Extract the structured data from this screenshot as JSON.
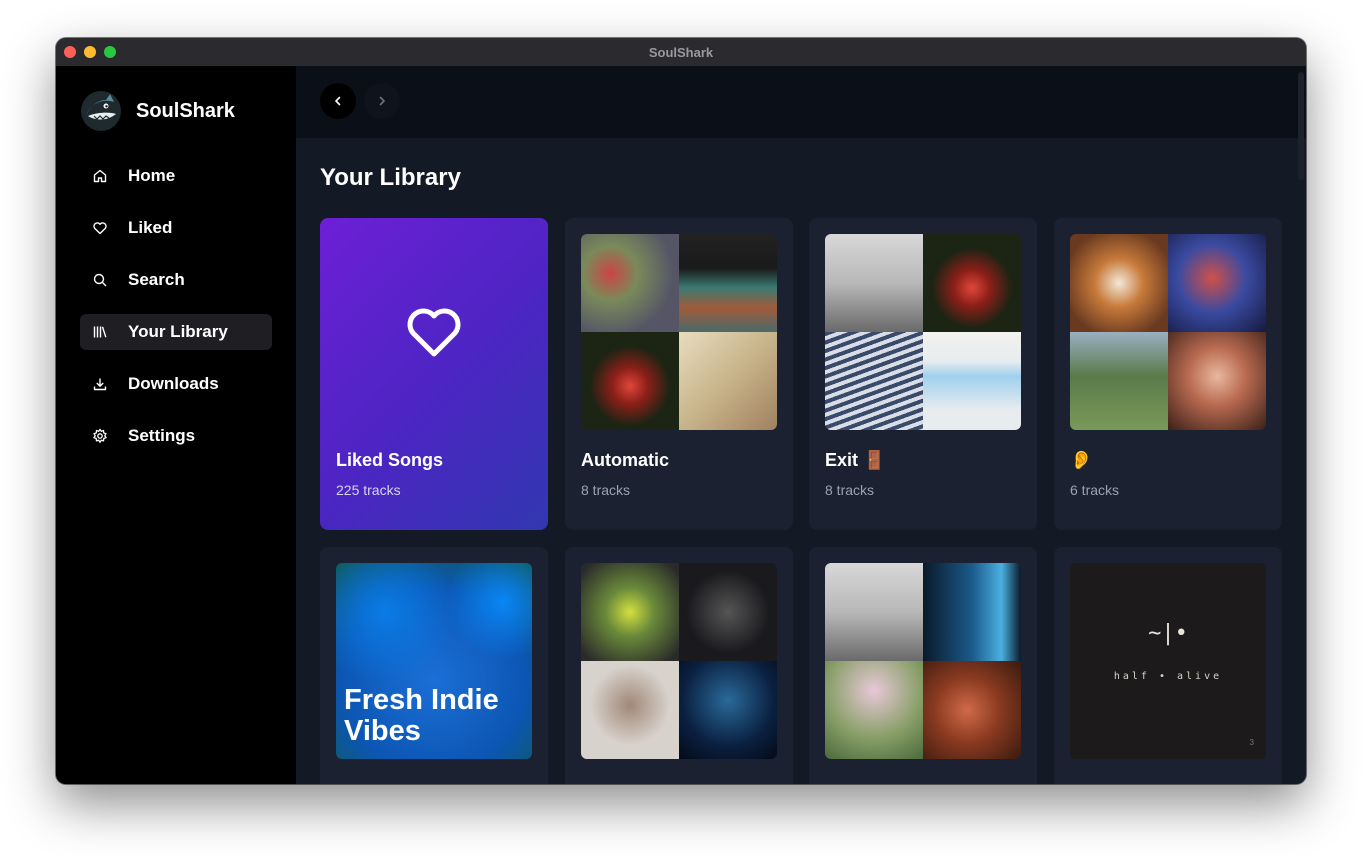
{
  "window": {
    "title": "SoulShark"
  },
  "brand": {
    "name": "SoulShark"
  },
  "sidebar": {
    "items": [
      {
        "label": "Home",
        "icon": "home-icon"
      },
      {
        "label": "Liked",
        "icon": "heart-icon"
      },
      {
        "label": "Search",
        "icon": "search-icon"
      },
      {
        "label": "Your Library",
        "icon": "library-icon",
        "active": true
      },
      {
        "label": "Downloads",
        "icon": "download-icon"
      },
      {
        "label": "Settings",
        "icon": "gear-icon"
      }
    ]
  },
  "main": {
    "title": "Your Library",
    "cards": [
      {
        "title": "Liked Songs",
        "subtitle": "225 tracks"
      },
      {
        "title": "Automatic",
        "subtitle": "8 tracks",
        "art": [
          "#8a7a4f",
          "#3a4a46",
          "#2a1f18",
          "#c9b99a"
        ]
      },
      {
        "title": "Exit 🚪",
        "subtitle": "8 tracks",
        "art": [
          "#9a9a9a",
          "#3b2018",
          "#2e3f58",
          "#d9e4ea"
        ]
      },
      {
        "title": "👂",
        "subtitle": "6 tracks",
        "art": [
          "#7a4a2c",
          "#2f3c7a",
          "#6f8a5a",
          "#c98a70"
        ]
      },
      {
        "art_text": "Fresh Indie Vibes"
      },
      {
        "art": [
          "#5f7d3a",
          "#1d1d22",
          "#cfc8c2",
          "#0f2540"
        ]
      },
      {
        "art": [
          "#9a9a9a",
          "#1f3d5a",
          "#4a6a3a",
          "#6a2a18"
        ]
      },
      {
        "art_symbol": "~|•",
        "art_name": "half • alive",
        "art_num": "3"
      }
    ]
  },
  "colors": {
    "accent_purple": "#6d1fd6",
    "sidebar_bg": "#000000",
    "main_bg": "#131a26",
    "card_bg": "#1b2130"
  }
}
